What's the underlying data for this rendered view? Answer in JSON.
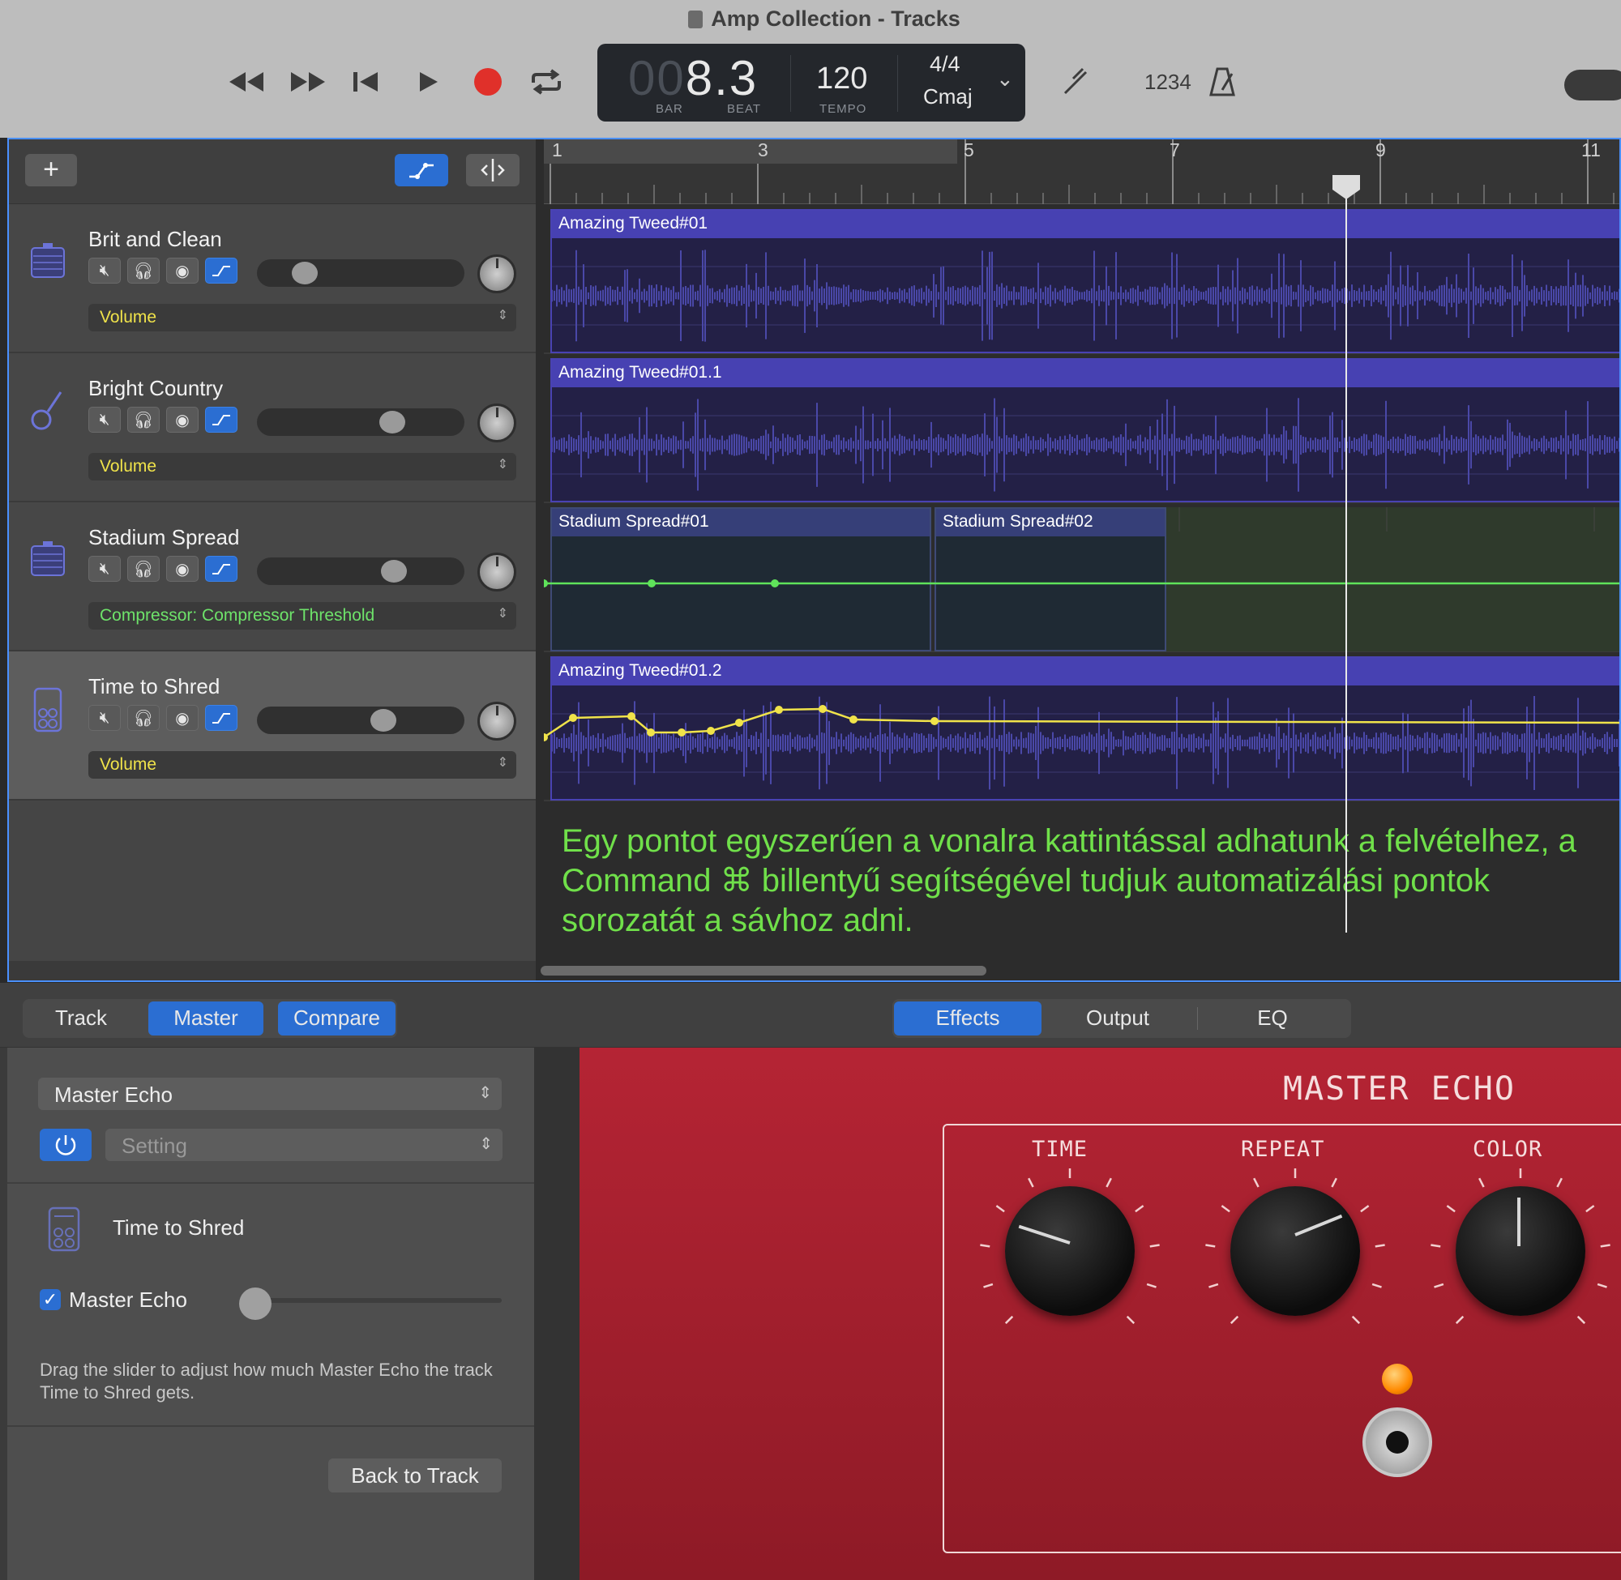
{
  "window": {
    "title": "Amp Collection - Tracks"
  },
  "lcd": {
    "bar_dim": "00",
    "position": "8.3",
    "bar_label": "BAR",
    "beat_label": "BEAT",
    "tempo": "120",
    "tempo_label": "TEMPO",
    "time_signature": "4/4",
    "key": "Cmaj"
  },
  "toolbar": {
    "count_in": "1234"
  },
  "ruler": {
    "bars": [
      "1",
      "3",
      "5",
      "7",
      "9",
      "11"
    ]
  },
  "tracks": [
    {
      "name": "Brit and Clean",
      "automation": "Volume",
      "automation_color": "#f0e34a",
      "volume_level": 0.18
    },
    {
      "name": "Bright Country",
      "automation": "Volume",
      "automation_color": "#f0e34a",
      "volume_level": 0.68
    },
    {
      "name": "Stadium Spread",
      "automation": "Compressor: Compressor Threshold",
      "automation_color": "#6ee36a",
      "volume_level": 0.69
    },
    {
      "name": "Time to Shred",
      "automation": "Volume",
      "automation_color": "#f0e34a",
      "volume_level": 0.63
    }
  ],
  "regions": {
    "r1": "Amazing Tweed#01",
    "r2": "Amazing Tweed#01.1",
    "r3": "Stadium Spread#01",
    "r4": "Stadium Spread#02",
    "r5": "Amazing Tweed#01.2"
  },
  "annotation": "Egy pontot egyszerűen a vonalra kattintással adhatunk a felvételhez, a Command ⌘ billentyű segítségével tudjuk automatizálási pontok sorozatát a sávhoz adni.",
  "bottom_tabs": {
    "track": "Track",
    "master": "Master",
    "compare": "Compare",
    "effects": "Effects",
    "output": "Output",
    "eq": "EQ"
  },
  "side": {
    "effect_select": "Master Echo",
    "setting_select": "Setting",
    "track_name": "Time to Shred",
    "send_label": "Master Echo",
    "send_checked": true,
    "send_level": 0.0,
    "help": "Drag the slider to adjust how much Master Echo the track Time to Shred gets.",
    "back_button": "Back to Track"
  },
  "plugin": {
    "title": "MASTER ECHO",
    "knobs": [
      "TIME",
      "REPEAT",
      "COLOR"
    ]
  },
  "colors": {
    "accent": "#2b6ed2",
    "record": "#e0302a",
    "region": "#4741b2",
    "plugin": "#b52434",
    "annotation": "#70e04a"
  }
}
